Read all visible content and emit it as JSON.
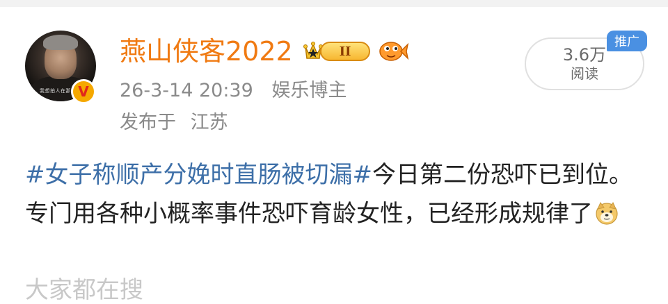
{
  "post": {
    "avatar_caption": "我想拍人在那边空",
    "verify_mark": "V",
    "username": "燕山侠客2022",
    "member_level": "II",
    "timestamp": "26-3-14 20:39",
    "user_tag": "娱乐博主",
    "location_prefix": "发布于",
    "location": "江苏",
    "views": {
      "count": "3.6万",
      "label": "阅读"
    },
    "promo_label": "推广",
    "hashtag": "#女子称顺产分娩时直肠被切漏#",
    "body_text": "今日第二份恐吓已到位。专门用各种小概率事件恐吓育龄女性，已经形成规律了",
    "next_line_partial": "大家都在搜"
  },
  "colors": {
    "username": "#f07a12",
    "hashtag": "#3d6fa8",
    "meta": "#8a8a8a",
    "promo": "#4a90e2"
  },
  "icons": {
    "verify": "verified-v-icon",
    "crown": "crown-icon",
    "fish": "fish-badge-icon",
    "emoji": "doge-emoji-icon"
  }
}
